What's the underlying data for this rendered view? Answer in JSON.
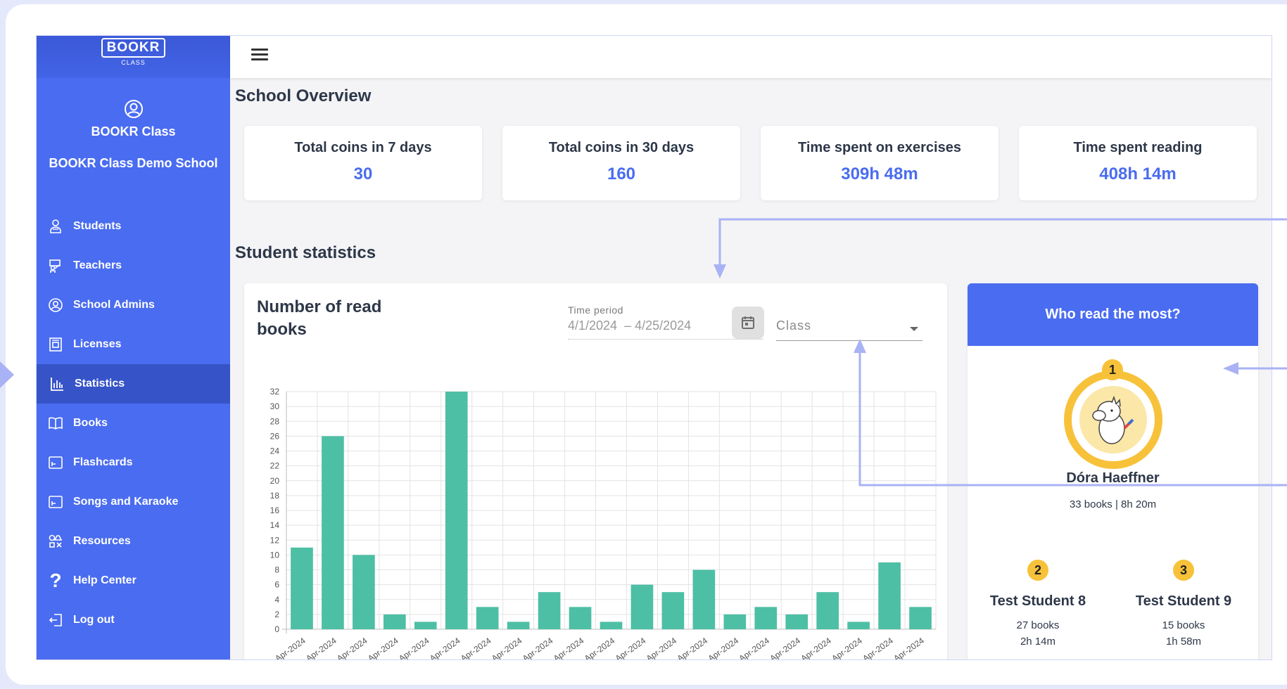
{
  "brand": {
    "logo": "BOOKR",
    "logo_sub": "CLASS"
  },
  "profile": {
    "name": "BOOKR Class",
    "school": "BOOKR Class Demo School"
  },
  "nav": [
    {
      "label": "Students",
      "icon": "student-icon"
    },
    {
      "label": "Teachers",
      "icon": "teacher-icon"
    },
    {
      "label": "School Admins",
      "icon": "admin-icon"
    },
    {
      "label": "Licenses",
      "icon": "license-icon"
    },
    {
      "label": "Statistics",
      "icon": "statistics-icon",
      "active": true
    },
    {
      "label": "Books",
      "icon": "book-icon"
    },
    {
      "label": "Flashcards",
      "icon": "flashcard-icon"
    },
    {
      "label": "Songs and Karaoke",
      "icon": "karaoke-icon"
    },
    {
      "label": "Resources",
      "icon": "resources-icon"
    },
    {
      "label": "Help Center",
      "icon": "help-icon"
    },
    {
      "label": "Log out",
      "icon": "logout-icon"
    }
  ],
  "overview": {
    "title": "School Overview",
    "cards": [
      {
        "label": "Total coins in 7 days",
        "value": "30"
      },
      {
        "label": "Total coins in 30 days",
        "value": "160"
      },
      {
        "label": "Time spent on exercises",
        "value": "309h 48m"
      },
      {
        "label": "Time spent reading",
        "value": "408h 14m"
      }
    ]
  },
  "statistics": {
    "title": "Student statistics",
    "chart_title": "Number of read books",
    "time_period_label": "Time period",
    "date_from": "4/1/2024",
    "date_to": "– 4/25/2024",
    "class_placeholder": "Class"
  },
  "leaderboard": {
    "title": "Who read the most?",
    "first": {
      "rank": "1",
      "name": "Dóra Haeffner",
      "stats": "33 books | 8h 20m"
    },
    "second": {
      "rank": "2",
      "name": "Test Student 8",
      "books": "27 books",
      "time": "2h 14m"
    },
    "third": {
      "rank": "3",
      "name": "Test Student 9",
      "books": "15 books",
      "time": "1h 58m"
    }
  },
  "colors": {
    "primary": "#4a6cf0",
    "sidebar_active": "#3653c8",
    "bar": "#4dbfa4",
    "gold": "#f7c23a",
    "annotation": "#a9b2f4"
  },
  "chart_data": {
    "type": "bar",
    "categories": [
      "Apr-2024",
      "Apr-2024",
      "Apr-2024",
      "Apr-2024",
      "Apr-2024",
      "Apr-2024",
      "Apr-2024",
      "Apr-2024",
      "Apr-2024",
      "Apr-2024",
      "Apr-2024",
      "Apr-2024",
      "Apr-2024",
      "Apr-2024",
      "Apr-2024",
      "Apr-2024",
      "Apr-2024",
      "Apr-2024",
      "Apr-2024",
      "Apr-2024",
      "Apr-2024"
    ],
    "values": [
      11,
      26,
      10,
      2,
      1,
      32,
      3,
      1,
      5,
      3,
      1,
      6,
      5,
      8,
      2,
      3,
      2,
      5,
      1,
      9,
      3
    ],
    "ylim": [
      0,
      32
    ],
    "yticks": [
      0,
      2,
      4,
      6,
      8,
      10,
      12,
      14,
      16,
      18,
      20,
      22,
      24,
      26,
      28,
      30,
      32
    ],
    "grid": true
  }
}
